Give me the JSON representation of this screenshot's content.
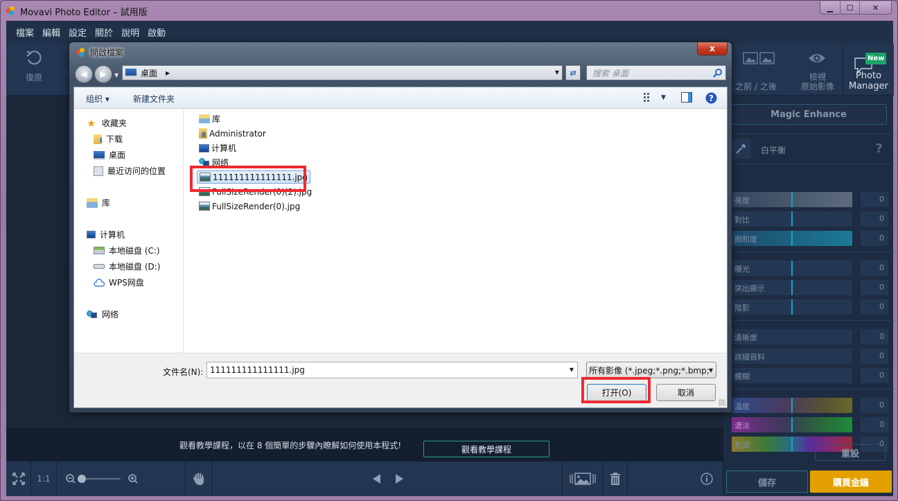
{
  "window": {
    "title": "Movavi Photo Editor – 試用版",
    "controls": {
      "minimize": "▁",
      "maximize": "☐",
      "close": "✕"
    }
  },
  "menubar": {
    "items": [
      "檔案",
      "編輯",
      "設定",
      "關於",
      "說明",
      "啟動"
    ]
  },
  "toolbar": {
    "undo_label": "復原"
  },
  "right_panel": {
    "before_after_label": "之前 / 之後",
    "view_original_line1": "檢視",
    "view_original_line2": "原始影像",
    "photo_manager_line1": "Photo",
    "photo_manager_line2": "Manager",
    "new_badge": "New",
    "magic_enhance": "Magic Enhance",
    "white_balance": "白平衡",
    "help": "?",
    "sliders": [
      {
        "label": "亮度",
        "value": "0",
        "style": "gray"
      },
      {
        "label": "對比",
        "value": "0",
        "style": "plain"
      },
      {
        "label": "飽和度",
        "value": "0",
        "style": "teal"
      },
      {
        "label": "曝光",
        "value": "0",
        "style": "plain"
      },
      {
        "label": "突出顯示",
        "value": "0",
        "style": "plain"
      },
      {
        "label": "陰影",
        "value": "0",
        "style": "plain"
      },
      {
        "label": "清晰度",
        "value": "0",
        "style": "nomark"
      },
      {
        "label": "詳細資料",
        "value": "0",
        "style": "nomark"
      },
      {
        "label": "模糊",
        "value": "0",
        "style": "nomark"
      },
      {
        "label": "溫度",
        "value": "0",
        "style": "temp"
      },
      {
        "label": "濃淡",
        "value": "0",
        "style": "tint"
      },
      {
        "label": "色調",
        "value": "0",
        "style": "hue"
      }
    ],
    "reset_label": "重設",
    "save_label": "儲存",
    "buy_label": "購買金鑰",
    "colors": {
      "accent": "#1c9fc8",
      "buy": "#e3a000",
      "new_badge": "#1ba267"
    }
  },
  "tutorial": {
    "text": "觀看教學課程，以在 8 個簡單的步驟內瞭解如何使用本程式!",
    "button_label": "觀看教學課程"
  },
  "bottombar": {
    "ratio_label": "1:1",
    "zoom_level": 0
  },
  "dialog": {
    "title": "開啟檔案",
    "close": "x",
    "address": {
      "location": "桌面"
    },
    "search_placeholder": "搜索 桌面",
    "commands": {
      "organize": "组织 ▾",
      "new_folder": "新建文件夹"
    },
    "nav": {
      "favorites": "收藏夹",
      "downloads": "下载",
      "desktop": "桌面",
      "recent": "最近访问的位置",
      "libraries": "库",
      "computer": "计算机",
      "drive_c": "本地磁盘 (C:)",
      "drive_d": "本地磁盘 (D:)",
      "wps": "WPS网盘",
      "network": "网络"
    },
    "files": [
      {
        "name": "库",
        "type": "library"
      },
      {
        "name": "Administrator",
        "type": "user"
      },
      {
        "name": "计算机",
        "type": "computer"
      },
      {
        "name": "网络",
        "type": "network"
      },
      {
        "name": "111111111111111.jpg",
        "type": "image",
        "selected": true
      },
      {
        "name": "FullSizeRender(0)(2).jpg",
        "type": "image"
      },
      {
        "name": "FullSizeRender(0).jpg",
        "type": "image"
      }
    ],
    "filename_label": "文件名(N):",
    "filename_value": "111111111111111.jpg",
    "filetype_value": "所有影像 (*.jpeg;*.png;*.bmp;",
    "open_label": "打开(O)",
    "cancel_label": "取消"
  }
}
